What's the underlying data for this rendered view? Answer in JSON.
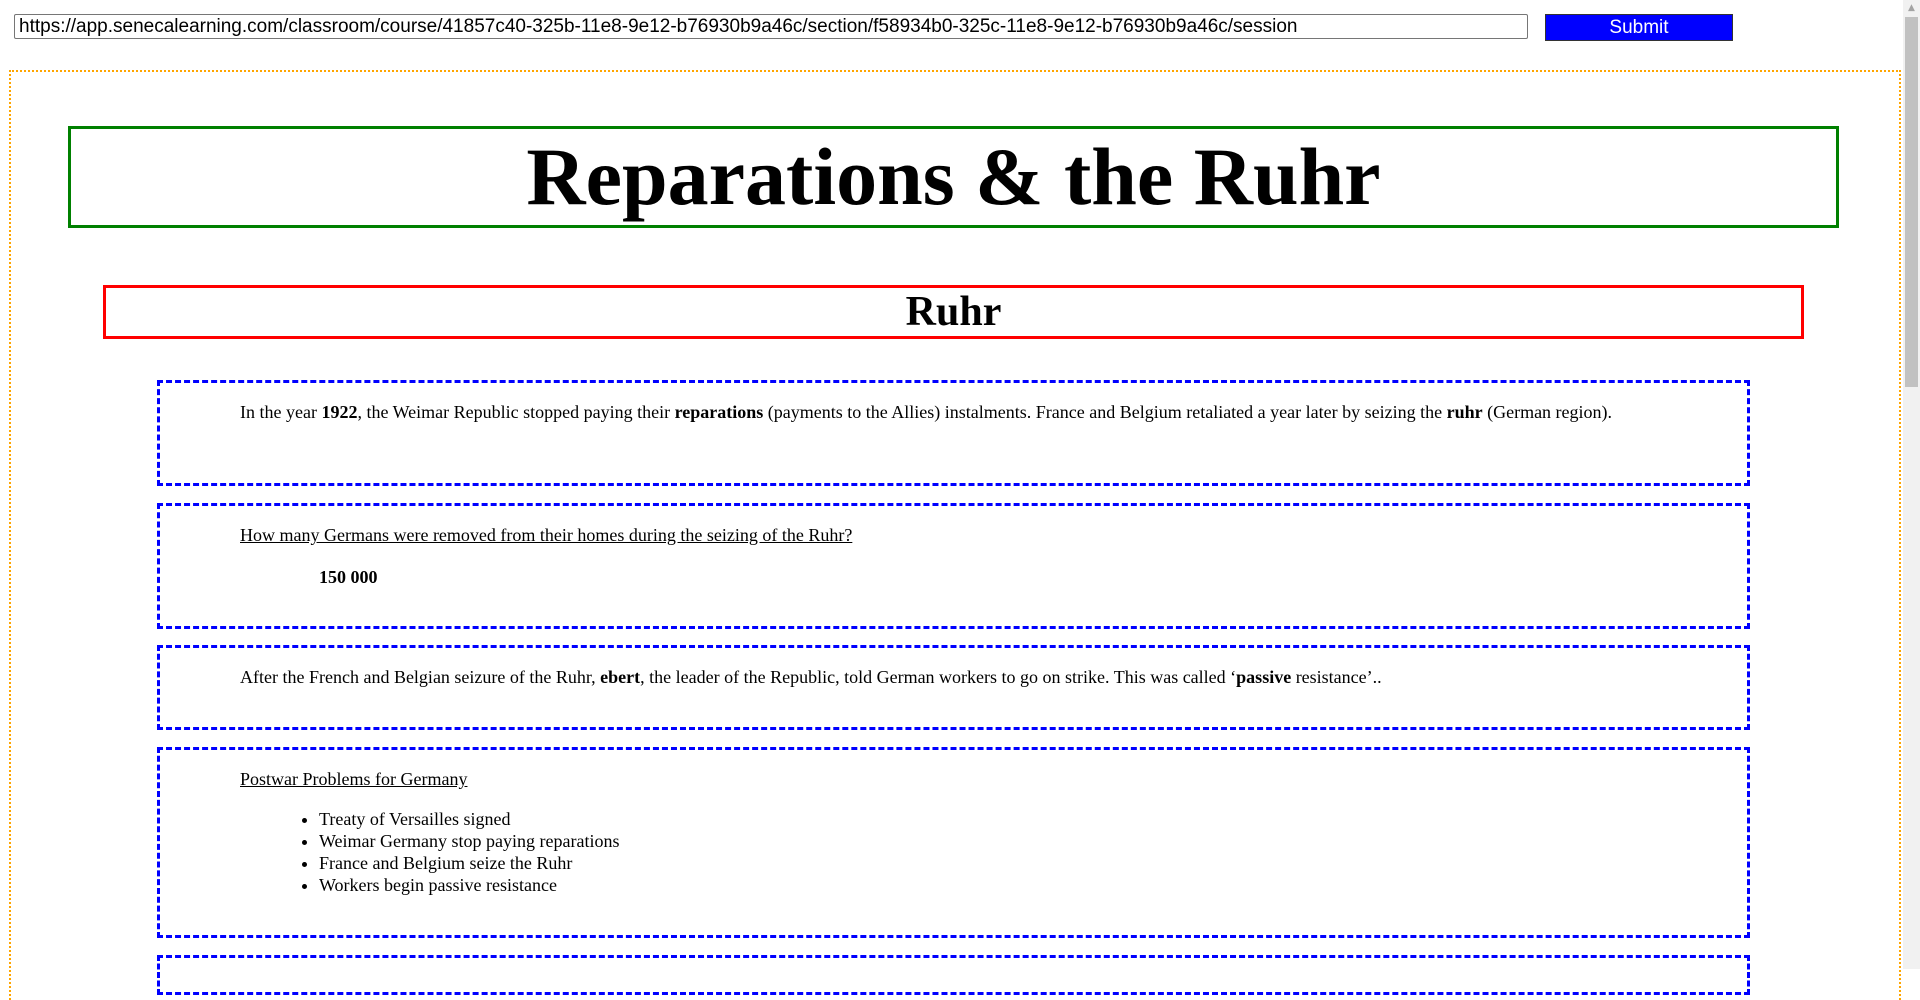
{
  "toolbar": {
    "url_value": "https://app.senecalearning.com/classroom/course/41857c40-325b-11e8-9e12-b76930b9a46c/section/f58934b0-325c-11e8-9e12-b76930b9a46c/session",
    "submit_label": "Submit"
  },
  "page": {
    "title": "Reparations & the Ruhr",
    "section_title": "Ruhr"
  },
  "cards": {
    "intro": {
      "t1": "In the year ",
      "b1": "1922",
      "t2": ", the Weimar Republic stopped paying their ",
      "b2": "reparations",
      "t3": " (payments to the Allies) instalments. France and Belgium retaliated a year later by seizing the ",
      "b3": "ruhr",
      "t4": " (German region)."
    },
    "question": {
      "prompt": "How many Germans were removed from their homes during the seizing of the Ruhr?",
      "answer": "150 000"
    },
    "strike": {
      "t1": "After the French and Belgian seizure of the Ruhr, ",
      "b1": "ebert",
      "t2": ", the leader of the Republic, told German workers to go on strike. This was called ‘",
      "b2": "passive",
      "t3": " resistance’.."
    },
    "problems": {
      "heading": "Postwar Problems for Germany",
      "items": [
        "Treaty of Versailles signed",
        "Weimar Germany stop paying reparations",
        "France and Belgium seize the Ruhr",
        "Workers begin passive resistance"
      ]
    }
  },
  "colors": {
    "submit_bg": "#0000ff",
    "frame_border": "#ffa500",
    "title_border": "#008000",
    "section_border": "#ff0000",
    "card_border": "#0000ff"
  },
  "icons": {
    "scroll_up": "triangle-up-icon"
  },
  "scrollbar": {
    "up_glyph": "▲"
  }
}
